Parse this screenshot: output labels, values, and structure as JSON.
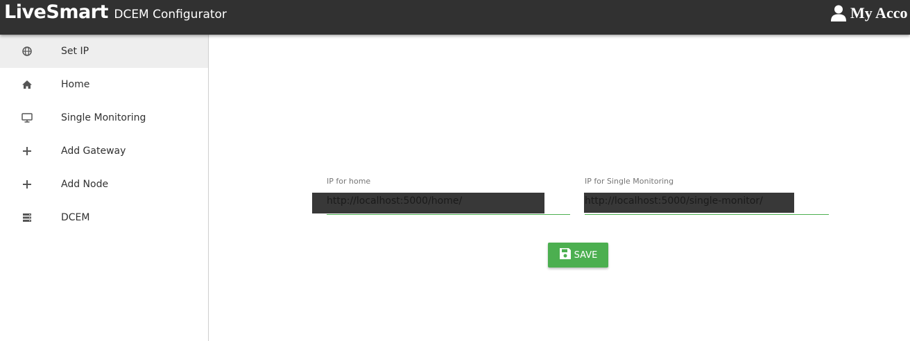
{
  "header": {
    "brand": "LiveSmart",
    "subtitle": "DCEM Configurator",
    "account_label": "My Acco",
    "account_icon": "user-icon"
  },
  "sidebar": {
    "items": [
      {
        "label": "Set IP",
        "icon": "globe-icon",
        "active": true
      },
      {
        "label": "Home",
        "icon": "home-icon",
        "active": false
      },
      {
        "label": "Single Monitoring",
        "icon": "monitor-icon",
        "active": false
      },
      {
        "label": "Add Gateway",
        "icon": "plus-icon",
        "active": false
      },
      {
        "label": "Add Node",
        "icon": "plus-icon",
        "active": false
      },
      {
        "label": "DCEM",
        "icon": "server-icon",
        "active": false
      }
    ]
  },
  "form": {
    "home_ip": {
      "label": "IP for home",
      "value": "http://localhost:5000/home/"
    },
    "single_ip": {
      "label": "IP for Single Monitoring",
      "value": "http://localhost:5000/single-monitor/"
    },
    "save_label": "SAVE",
    "save_icon": "floppy-disk-icon"
  },
  "colors": {
    "topbar": "#313131",
    "accent": "#4caf50",
    "active_nav": "#eeeeee"
  }
}
